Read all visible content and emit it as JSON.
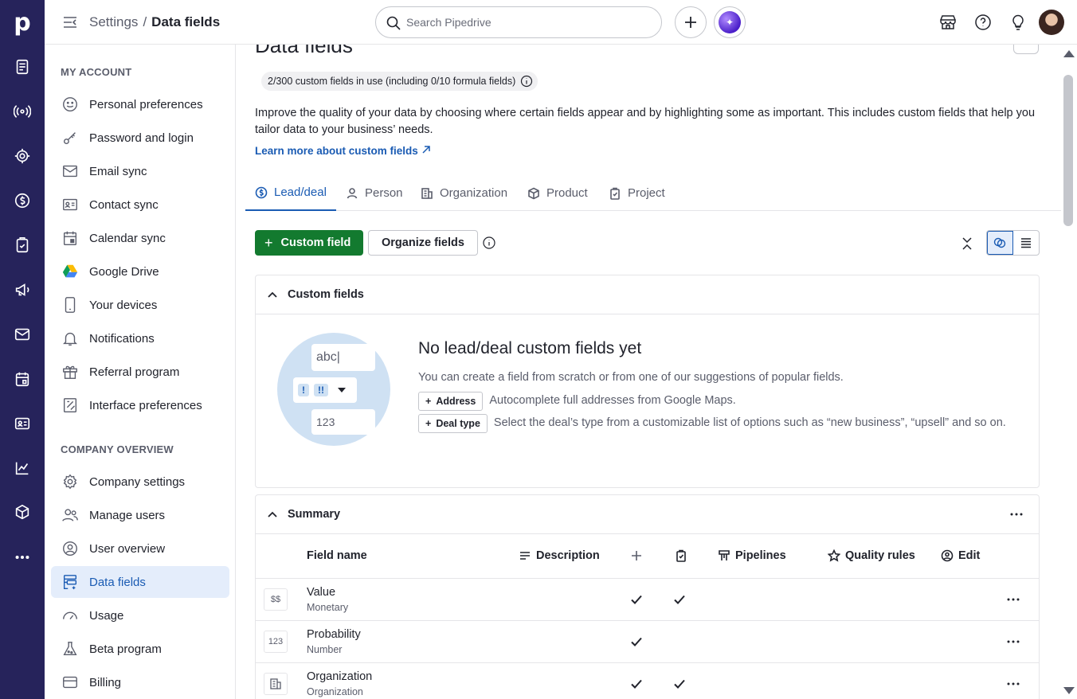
{
  "app": {
    "logo": "p"
  },
  "header": {
    "breadcrumb_parent": "Settings",
    "breadcrumb_separator": "/",
    "breadcrumb_current": "Data fields",
    "search_placeholder": "Search Pipedrive"
  },
  "rail": {
    "icons": [
      "leads-icon",
      "deals-icon",
      "activities-icon",
      "money-icon",
      "tasks-icon",
      "campaigns-icon",
      "mail-icon",
      "calendar-icon",
      "contacts-icon",
      "insights-icon",
      "products-icon",
      "more-icon"
    ]
  },
  "sidebar": {
    "my_account_title": "MY ACCOUNT",
    "my_account": [
      {
        "label": "Personal preferences",
        "icon": "smiley-icon"
      },
      {
        "label": "Password and login",
        "icon": "key-icon"
      },
      {
        "label": "Email sync",
        "icon": "envelope-icon"
      },
      {
        "label": "Contact sync",
        "icon": "contact-card-icon"
      },
      {
        "label": "Calendar sync",
        "icon": "calendar-icon"
      },
      {
        "label": "Google Drive",
        "icon": "google-drive-icon"
      },
      {
        "label": "Your devices",
        "icon": "phone-icon"
      },
      {
        "label": "Notifications",
        "icon": "bell-icon"
      },
      {
        "label": "Referral program",
        "icon": "gift-icon"
      },
      {
        "label": "Interface preferences",
        "icon": "interface-icon"
      }
    ],
    "company_title": "COMPANY OVERVIEW",
    "company": [
      {
        "label": "Company settings",
        "icon": "gear-icon"
      },
      {
        "label": "Manage users",
        "icon": "users-icon"
      },
      {
        "label": "User overview",
        "icon": "user-circle-icon"
      },
      {
        "label": "Data fields",
        "icon": "data-fields-icon",
        "active": true
      },
      {
        "label": "Usage",
        "icon": "gauge-icon"
      },
      {
        "label": "Beta program",
        "icon": "flask-icon"
      },
      {
        "label": "Billing",
        "icon": "credit-card-icon"
      }
    ]
  },
  "page": {
    "title": "Data fields",
    "usage_pill": "2/300 custom fields in use (including 0/10 formula fields)",
    "description": "Improve the quality of your data by choosing where certain fields appear and by highlighting some as important. This includes custom fields that help you tailor data to your business’ needs.",
    "learn_more": "Learn more about custom fields",
    "tabs": [
      {
        "label": "Lead/deal",
        "icon": "dollar-circle-icon",
        "active": true
      },
      {
        "label": "Person",
        "icon": "person-icon"
      },
      {
        "label": "Organization",
        "icon": "building-icon"
      },
      {
        "label": "Product",
        "icon": "box-icon"
      },
      {
        "label": "Project",
        "icon": "clipboard-icon"
      }
    ],
    "custom_field_button": "Custom field",
    "custom_field_plus": "+",
    "organize_button": "Organize fields"
  },
  "custom_fields": {
    "title": "Custom fields",
    "illustration": {
      "text_field": "abc|",
      "tag1": "!",
      "tag2": "!!",
      "number_field": "123"
    },
    "empty_title": "No lead/deal custom fields yet",
    "empty_sub": "You can create a field from scratch or from one of our suggestions of popular fields.",
    "suggestions": [
      {
        "label": "Address",
        "text": "Autocomplete full addresses from Google Maps."
      },
      {
        "label": "Deal type",
        "text": "Select the deal’s type from a customizable list of options such as “new business”, “upsell” and so on."
      }
    ]
  },
  "summary": {
    "title": "Summary",
    "columns": {
      "field_name": "Field name",
      "description": "Description",
      "pipelines": "Pipelines",
      "quality_rules": "Quality rules",
      "edit": "Edit"
    },
    "rows": [
      {
        "icon": "$$",
        "name": "Value",
        "type": "Monetary",
        "add_check": true,
        "project_check": true
      },
      {
        "icon": "123",
        "name": "Probability",
        "type": "Number",
        "add_check": true,
        "project_check": false
      },
      {
        "icon": "org",
        "name": "Organization",
        "type": "Organization",
        "add_check": true,
        "project_check": true
      }
    ]
  },
  "colors": {
    "rail": "#26235b",
    "accent": "#1a5bb3",
    "primary_button": "#137a2f",
    "active_bg": "#e4edfb"
  }
}
